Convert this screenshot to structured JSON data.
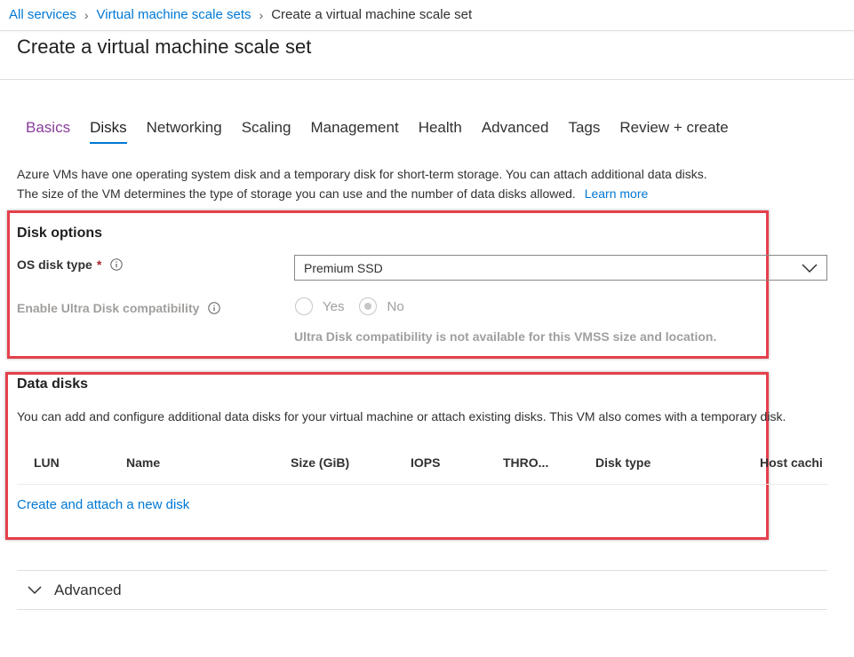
{
  "breadcrumb": {
    "items": [
      "All services",
      "Virtual machine scale sets"
    ],
    "current": "Create a virtual machine scale set"
  },
  "page_title": "Create a virtual machine scale set",
  "tabs": [
    {
      "label": "Basics",
      "state": "visited"
    },
    {
      "label": "Disks",
      "state": "active"
    },
    {
      "label": "Networking",
      "state": "default"
    },
    {
      "label": "Scaling",
      "state": "default"
    },
    {
      "label": "Management",
      "state": "default"
    },
    {
      "label": "Health",
      "state": "default"
    },
    {
      "label": "Advanced",
      "state": "default"
    },
    {
      "label": "Tags",
      "state": "default"
    },
    {
      "label": "Review + create",
      "state": "default"
    }
  ],
  "intro": {
    "line1": "Azure VMs have one operating system disk and a temporary disk for short-term storage. You can attach additional data disks.",
    "line2": "The size of the VM determines the type of storage you can use and the number of data disks allowed.",
    "learn_more": "Learn more"
  },
  "disk_options": {
    "title": "Disk options",
    "os_disk_type_label": "OS disk type",
    "required_marker": "*",
    "os_disk_type_value": "Premium SSD",
    "ultra_label": "Enable Ultra Disk compatibility",
    "ultra_yes": "Yes",
    "ultra_no": "No",
    "ultra_selected": "No",
    "ultra_note": "Ultra Disk compatibility is not available for this VMSS size and location."
  },
  "data_disks": {
    "title": "Data disks",
    "description": "You can add and configure additional data disks for your virtual machine or attach existing disks. This VM also comes with a temporary disk.",
    "columns": [
      "LUN",
      "Name",
      "Size (GiB)",
      "IOPS",
      "THRO...",
      "Disk type",
      "Host cachi"
    ],
    "create_link": "Create and attach a new disk"
  },
  "advanced_section": {
    "label": "Advanced"
  },
  "colors": {
    "accent": "#0078d4",
    "visited_tab": "#8a3e9c",
    "highlight": "#e5404b",
    "required": "#a4262c",
    "disabled_text": "#a19f9d"
  }
}
